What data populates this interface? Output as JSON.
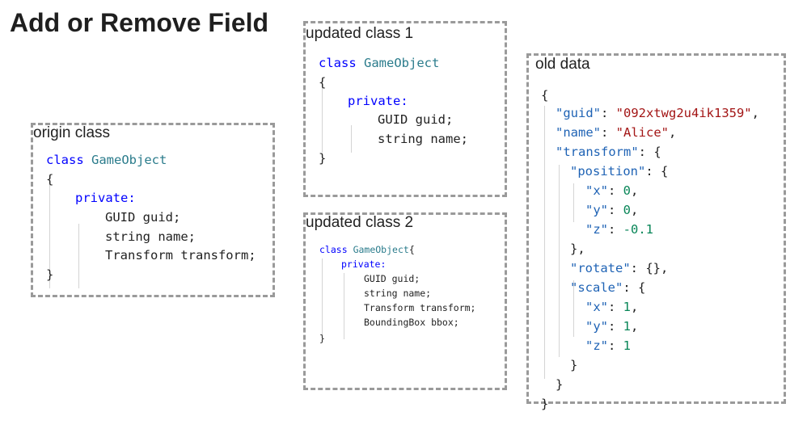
{
  "title": "Add or Remove Field",
  "origin": {
    "label": "origin class",
    "keyword_class": "class",
    "class_name": "GameObject",
    "open_brace": "{",
    "access": "private:",
    "fields": [
      "GUID guid;",
      "string name;",
      "Transform transform;"
    ],
    "close_brace": "}"
  },
  "updated1": {
    "label": "updated class 1",
    "keyword_class": "class",
    "class_name": "GameObject",
    "open_brace": "{",
    "access": "private:",
    "fields": [
      "GUID guid;",
      "string name;"
    ],
    "close_brace": "}"
  },
  "updated2": {
    "label": "updated class 2",
    "keyword_class": "class",
    "class_name": "GameObject",
    "open_brace_inline": "{",
    "access": "private:",
    "fields": [
      "GUID guid;",
      "string name;",
      "Transform transform;",
      "BoundingBox bbox;"
    ],
    "close_brace": "}"
  },
  "olddata": {
    "label": "old data",
    "open": "{",
    "guid_key": "\"guid\"",
    "guid_val": "\"092xtwg2u4ik1359\"",
    "name_key": "\"name\"",
    "name_val": "\"Alice\"",
    "transform_key": "\"transform\"",
    "position_key": "\"position\"",
    "x_key": "\"x\"",
    "pos_x": "0",
    "y_key": "\"y\"",
    "pos_y": "0",
    "z_key": "\"z\"",
    "pos_z": "-0.1",
    "rotate_key": "\"rotate\"",
    "rotate_val": "{}",
    "scale_key": "\"scale\"",
    "scale_x": "1",
    "scale_y": "1",
    "scale_z": "1",
    "close": "}"
  }
}
